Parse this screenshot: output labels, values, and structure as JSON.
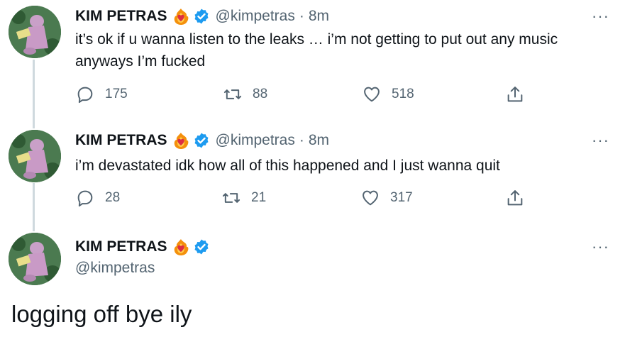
{
  "tweets": [
    {
      "name": "KIM PETRAS",
      "handle": "@kimpetras",
      "time": "8m",
      "text": "it’s ok if u wanna listen to the leaks … i’m not getting to put out any music anyways I’m fucked",
      "replies": "175",
      "retweets": "88",
      "likes": "518",
      "more": "···"
    },
    {
      "name": "KIM PETRAS",
      "handle": "@kimpetras",
      "time": "8m",
      "text": "i’m devastated idk how all of this happened and I just wanna quit",
      "replies": "28",
      "retweets": "21",
      "likes": "317",
      "more": "···"
    }
  ],
  "main_tweet": {
    "name": "KIM PETRAS",
    "handle": "@kimpetras",
    "text": "logging off bye ily",
    "more": "···"
  },
  "colors": {
    "verified": "#1d9bf0",
    "muted": "#536471",
    "thread_line": "#cfd9de"
  },
  "icons": [
    "heart-on-fire-emoji",
    "verified-badge-icon",
    "reply-icon",
    "retweet-icon",
    "like-icon",
    "share-icon",
    "more-icon"
  ]
}
